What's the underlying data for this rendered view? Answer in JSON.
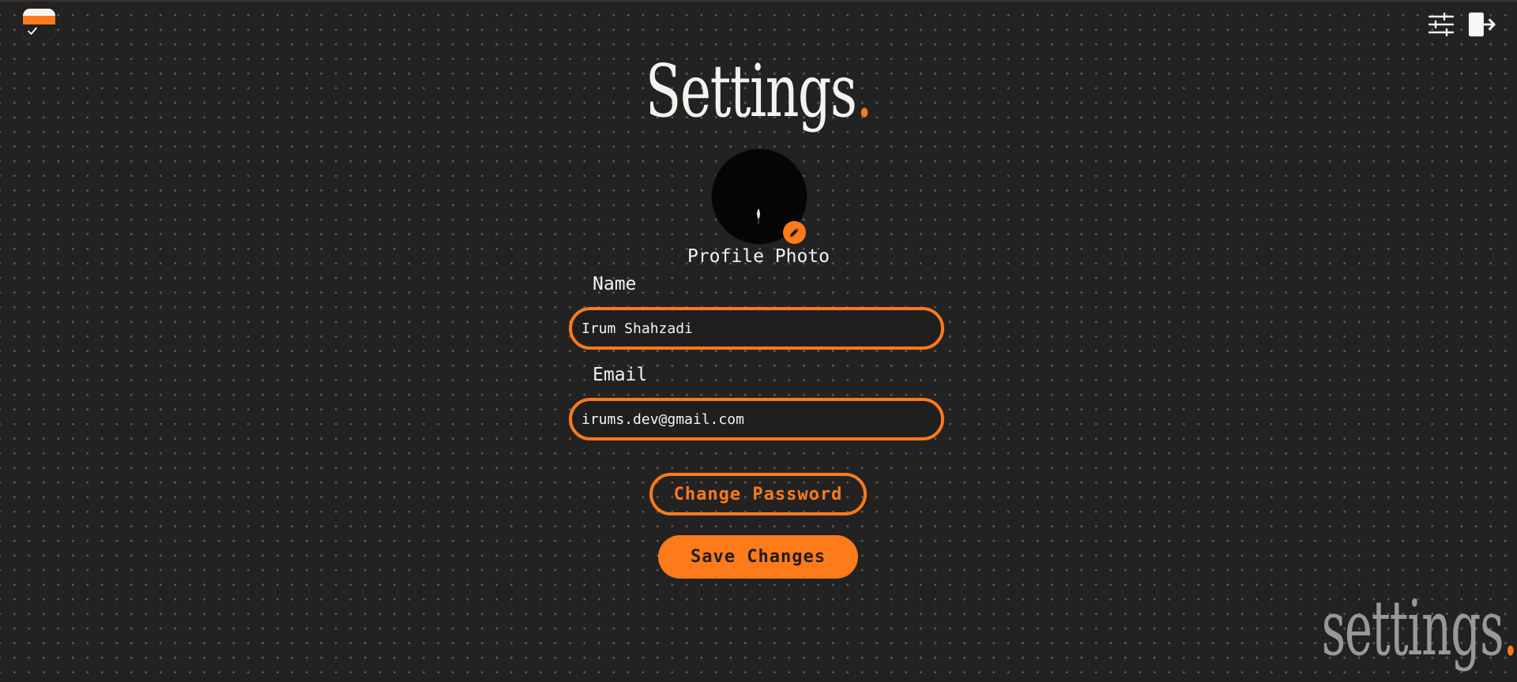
{
  "header": {
    "logo_icon": "checkbox-app-logo-icon",
    "settings_icon": "sliders-icon",
    "logout_icon": "logout-icon"
  },
  "page": {
    "title": "Settings",
    "title_dot": ".",
    "watermark": "settings",
    "watermark_dot": "."
  },
  "profile": {
    "photo_label": "Profile Photo",
    "edit_icon": "pencil-icon"
  },
  "form": {
    "name_label": "Name",
    "name_value": "Irum Shahzadi",
    "email_label": "Email",
    "email_value": "irums.dev@gmail.com"
  },
  "actions": {
    "change_password_label": "Change Password",
    "save_label": "Save Changes"
  },
  "colors": {
    "background": "#232222",
    "accent": "#ff7a1a",
    "text": "#f2f2f2",
    "watermark": "#9a9896"
  }
}
